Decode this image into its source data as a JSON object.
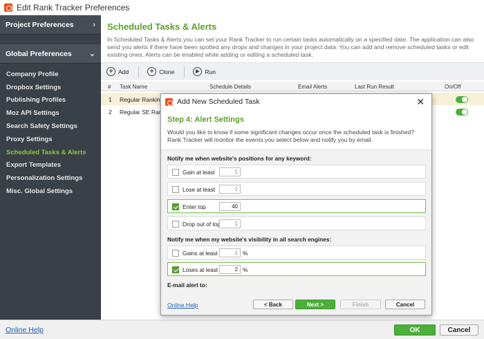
{
  "window": {
    "title": "Edit Rank Tracker Preferences"
  },
  "sidebar": {
    "groups": [
      {
        "label": "Project Preferences",
        "chevron": "›"
      },
      {
        "label": "Global Preferences",
        "chevron": "⌄"
      }
    ],
    "items": [
      {
        "label": "Company Profile"
      },
      {
        "label": "Dropbox Settings"
      },
      {
        "label": "Publishing Profiles"
      },
      {
        "label": "Moz API Settings"
      },
      {
        "label": "Search Safety Settings"
      },
      {
        "label": "Proxy Settings"
      },
      {
        "label": "Scheduled Tasks & Alerts"
      },
      {
        "label": "Export Templates"
      },
      {
        "label": "Personalization Settings"
      },
      {
        "label": "Misc. Global Settings"
      }
    ],
    "active_item": "Scheduled Tasks & Alerts"
  },
  "main": {
    "title": "Scheduled Tasks & Alerts",
    "description": "In Scheduled Tasks & Alerts you can set your Rank Tracker to run certain tasks automatically on a specified date. The application can also send you alerts if there have been spotted any drops and changes in your project data. You can add and remove scheduled tasks or edit existing ones. Alerts can be enabled while adding or editing a scheduled task.",
    "toolbar": {
      "add": "Add",
      "clone": "Clone",
      "run": "Run"
    },
    "table": {
      "columns": [
        "#",
        "Task Name",
        "Schedule Details",
        "Email Alerts",
        "Last Run Result",
        "On/Off"
      ],
      "rows": [
        {
          "num": "1",
          "name": "Regular Rankings",
          "on": true
        },
        {
          "num": "2",
          "name": "Regular SE Rankin",
          "on": true
        }
      ]
    }
  },
  "dialog": {
    "title": "Add New Scheduled Task",
    "step": "Step 4: Alert Settings",
    "description": "Would you like to know if some significant changes occur once the scheduled task is finished? Rank Tracker will monitor the events you select below and notify you by email.",
    "section1": "Notify me when website's positions for any keyword:",
    "options1": [
      {
        "label": "Gain at least",
        "value": "1",
        "checked": false
      },
      {
        "label": "Lose at least",
        "value": "1",
        "checked": false
      },
      {
        "label": "Enter top",
        "value": "40",
        "checked": true
      },
      {
        "label": "Drop out of top",
        "value": "1",
        "checked": false
      }
    ],
    "section2": "Notify me when my website's visibility in all search engines:",
    "options2": [
      {
        "label": "Gains at least",
        "value": "1",
        "unit": "%",
        "checked": false
      },
      {
        "label": "Loses at least",
        "value": "2",
        "unit": "%",
        "checked": true
      }
    ],
    "section3": "E-mail alert to:",
    "help": "Online Help",
    "buttons": {
      "back": "< Back",
      "next": "Next >",
      "finish": "Finish",
      "cancel": "Cancel"
    }
  },
  "footer": {
    "help": "Online Help",
    "ok": "OK",
    "cancel": "Cancel"
  },
  "colors": {
    "accent_green": "#5aa02c",
    "button_green": "#4caf3a",
    "sidebar_bg": "#3a4047",
    "link_blue": "#1a5fb4",
    "selected_row": "#f7f0d8"
  }
}
